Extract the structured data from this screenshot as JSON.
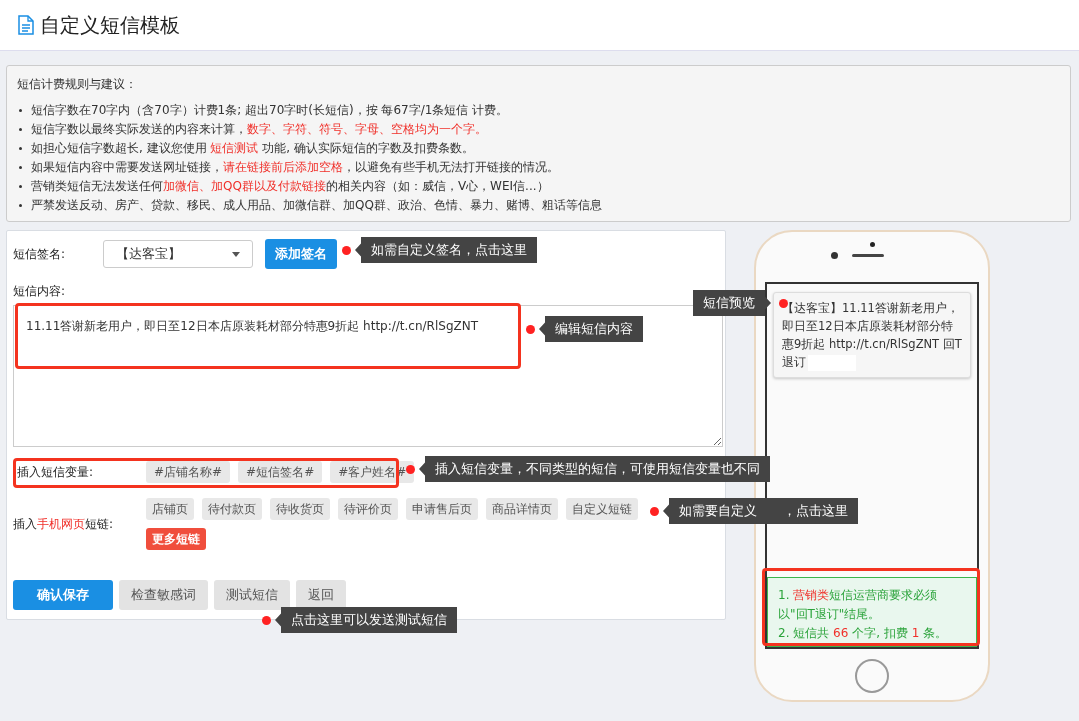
{
  "page": {
    "title": "自定义短信模板"
  },
  "rules": {
    "heading": "短信计费规则与建议：",
    "items": [
      [
        {
          "text": "短信字数在70字内（含70字）计费1条; 超出70字时(长短信)，按 每67字/1条短信 计费。",
          "highlight": false
        }
      ],
      [
        {
          "text": "短信字数以最终实际发送的内容来计算，",
          "highlight": false
        },
        {
          "text": "数字、字符、符号、字母、空格均为一个字。",
          "highlight": true
        }
      ],
      [
        {
          "text": "如担心短信字数超长, 建议您使用 ",
          "highlight": false
        },
        {
          "text": "短信测试",
          "highlight": true
        },
        {
          "text": " 功能, 确认实际短信的字数及扣费条数。",
          "highlight": false
        }
      ],
      [
        {
          "text": "如果短信内容中需要发送网址链接，",
          "highlight": false
        },
        {
          "text": "请在链接前后添加空格",
          "highlight": true
        },
        {
          "text": "，以避免有些手机无法打开链接的情况。",
          "highlight": false
        }
      ],
      [
        {
          "text": "营销类短信无法发送任何",
          "highlight": false
        },
        {
          "text": "加微信、加QQ群以及付款链接",
          "highlight": true
        },
        {
          "text": "的相关内容（如：威信，V心，WEI信...）",
          "highlight": false
        }
      ],
      [
        {
          "text": "严禁发送反动、房产、贷款、移民、成人用品、加微信群、加QQ群、政治、色情、暴力、赌博、粗话等信息",
          "highlight": false
        }
      ]
    ]
  },
  "form": {
    "signature": {
      "label": "短信签名:",
      "value": "【达客宝】",
      "add_button": "添加签名"
    },
    "content": {
      "label": "短信内容:",
      "value": "11.11答谢新老用户，即日至12日本店原装耗材部分特惠9折起 http://t.cn/RlSgZNT"
    },
    "variables": {
      "label": "插入短信变量:",
      "chips": [
        "#店铺名称#",
        "#短信签名#",
        "#客户姓名#"
      ]
    },
    "short_links": {
      "label": [
        {
          "text": "插入",
          "highlight": false
        },
        {
          "text": "手机网页",
          "highlight": true
        },
        {
          "text": "短链:",
          "highlight": false
        }
      ],
      "chips": [
        "店铺页",
        "待付款页",
        "待收货页",
        "待评价页",
        "申请售后页",
        "商品详情页",
        "自定义短链"
      ],
      "more_button": "更多短链"
    },
    "buttons": [
      {
        "label": "确认保存",
        "kind": "primary"
      },
      {
        "label": "检查敏感词",
        "kind": "default"
      },
      {
        "label": "测试短信",
        "kind": "default"
      },
      {
        "label": "返回",
        "kind": "default"
      }
    ]
  },
  "preview": {
    "message": "【达客宝】11.11答谢新老用户，即日至12日本店原装耗材部分特惠9折起 http://t.cn/RlSgZNT 回T退订",
    "notice": [
      [
        {
          "text": "1. ",
          "highlight": false
        },
        {
          "text": "营销类",
          "highlight": true
        },
        {
          "text": "短信运营商要求必须以\"回T退订\"结尾。",
          "highlight": false
        }
      ],
      [
        {
          "text": "2. 短信共 ",
          "highlight": false
        },
        {
          "text": "66",
          "highlight": true
        },
        {
          "text": " 个字, 扣费 ",
          "highlight": false
        },
        {
          "text": "1",
          "highlight": true
        },
        {
          "text": " 条。",
          "highlight": false
        }
      ]
    ]
  },
  "callouts": [
    {
      "text": "如需自定义签名，点击这里",
      "kind": "signature"
    },
    {
      "text": "编辑短信内容",
      "kind": "content"
    },
    {
      "text": "短信预览",
      "kind": "preview"
    },
    {
      "text": "插入短信变量，不同类型的短信，可使用短信变量也不同",
      "kind": "variables"
    },
    {
      "text": "如需要自定义　　，点击这里",
      "kind": "shortlinks"
    },
    {
      "text": "点击这里可以发送测试短信",
      "kind": "test"
    }
  ]
}
